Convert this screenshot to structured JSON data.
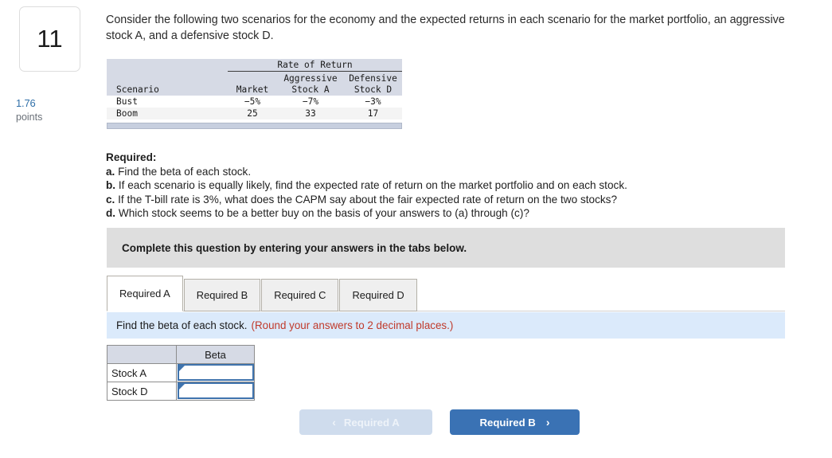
{
  "question": {
    "number": "11",
    "points_value": "1.76",
    "points_label": "points",
    "prompt": "Consider the following two scenarios for the economy and the expected returns in each scenario for the market portfolio, an aggressive stock A, and a defensive stock D."
  },
  "scenario_table": {
    "group_header": "Rate of Return",
    "sub_headers": [
      "",
      "",
      "Aggressive",
      "Defensive"
    ],
    "column_headers": [
      "Scenario",
      "Market",
      "Stock A",
      "Stock D"
    ],
    "rows": [
      {
        "scenario": "Bust",
        "market": "−5%",
        "stock_a": "−7%",
        "stock_d": "−3%"
      },
      {
        "scenario": "Boom",
        "market": "25",
        "stock_a": "33",
        "stock_d": "17"
      }
    ]
  },
  "required": {
    "heading": "Required:",
    "items": [
      {
        "key": "a.",
        "text": "Find the beta of each stock."
      },
      {
        "key": "b.",
        "text": "If each scenario is equally likely, find the expected rate of return on the market portfolio and on each stock."
      },
      {
        "key": "c.",
        "text": "If the T-bill rate is 3%, what does the CAPM say about the fair expected rate of return on the two stocks?"
      },
      {
        "key": "d.",
        "text": "Which stock seems to be a better buy on the basis of your answers to (a) through (c)?"
      }
    ]
  },
  "instruction_band": {
    "text": "Complete this question by entering your answers in the tabs below."
  },
  "tabs": [
    {
      "label": "Required A",
      "active": true
    },
    {
      "label": "Required B",
      "active": false
    },
    {
      "label": "Required C",
      "active": false
    },
    {
      "label": "Required D",
      "active": false
    }
  ],
  "sub_instruction": {
    "main": "Find the beta of each stock.",
    "note": "(Round your answers to 2 decimal places.)"
  },
  "answer_table": {
    "header_blank": "",
    "header_beta": "Beta",
    "rows": [
      {
        "label": "Stock A",
        "value": ""
      },
      {
        "label": "Stock D",
        "value": ""
      }
    ]
  },
  "nav": {
    "prev_label": "Required A",
    "prev_chevron": "‹",
    "next_label": "Required B",
    "next_chevron": "›"
  },
  "colors": {
    "accent_blue": "#3a72b4",
    "prev_button": "#cfdced",
    "table_header": "#d6dae5",
    "info_band": "#dbeafb",
    "instruction_band": "#dedede",
    "note_red": "#c03a2b",
    "points_blue": "#2f6fa8"
  }
}
